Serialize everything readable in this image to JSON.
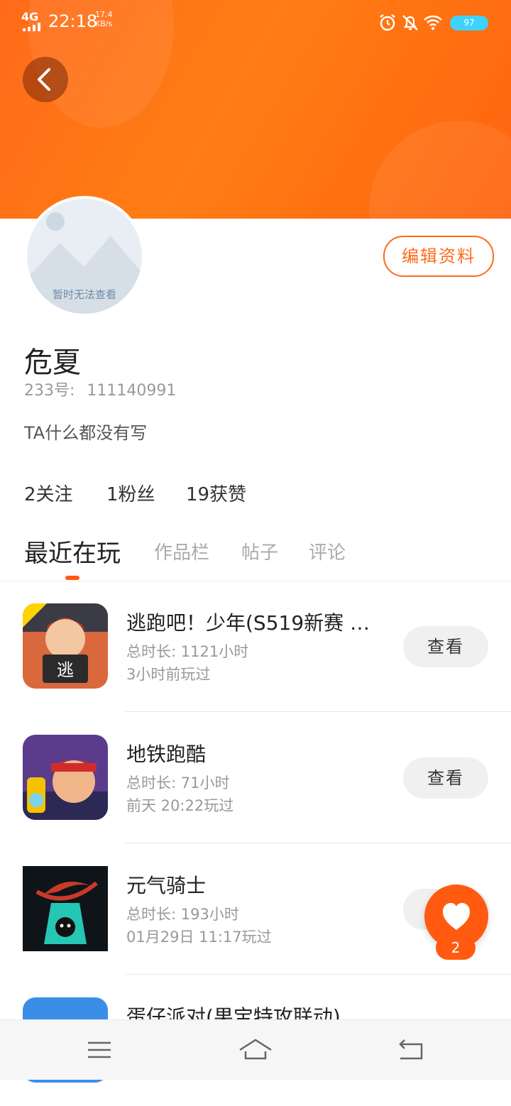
{
  "status_bar": {
    "network": "4G",
    "time": "22:18",
    "speed_value": "17.4",
    "speed_unit": "KB/s",
    "battery": "97",
    "icons": [
      "alarm-icon",
      "bell-off-icon",
      "wifi-icon",
      "battery-icon"
    ]
  },
  "header": {
    "back_icon": "chevron-left-icon",
    "gradient_colors": [
      "#ff6a1a",
      "#ff7d14"
    ]
  },
  "profile": {
    "avatar_placeholder": "暂时无法查看",
    "edit_label": "编辑资料",
    "name": "危夏",
    "uid_label": "233号:",
    "uid_value": "111140991",
    "bio": "TA什么都没有写",
    "stats": [
      {
        "label": "2关注"
      },
      {
        "label": "1粉丝"
      },
      {
        "label": "19获赞"
      }
    ]
  },
  "tabs": [
    {
      "label": "最近在玩",
      "active": true
    },
    {
      "label": "作品栏",
      "active": false
    },
    {
      "label": "帖子",
      "active": false
    },
    {
      "label": "评论",
      "active": false
    }
  ],
  "games": [
    {
      "title": "逃跑吧！少年(S519新赛 …",
      "duration": "总时长: 1121小时",
      "last_played": "3小时前玩过",
      "button": "查看"
    },
    {
      "title": "地铁跑酷",
      "duration": "总时长: 71小时",
      "last_played": "前天 20:22玩过",
      "button": "查看"
    },
    {
      "title": "元气骑士",
      "duration": "总时长: 193小时",
      "last_played": "01月29日 11:17玩过",
      "button": "查看"
    },
    {
      "title": "蛋仔派对(果宝特攻联动)",
      "duration": "",
      "last_played": "",
      "button": ""
    }
  ],
  "fab": {
    "icon": "heart-icon",
    "count": "2"
  },
  "navbar": {
    "icons": [
      "menu-icon",
      "home-icon",
      "back-icon"
    ]
  },
  "accent_color": "#ff5a10"
}
